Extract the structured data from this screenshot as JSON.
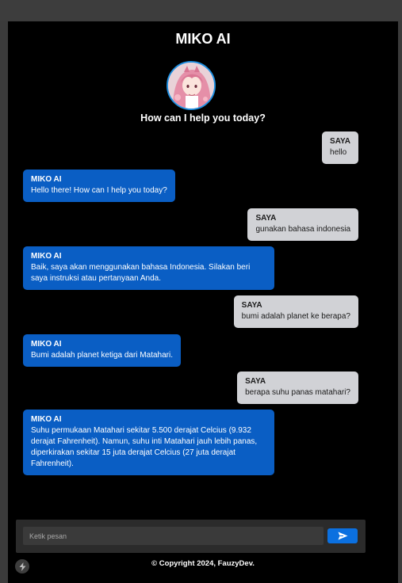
{
  "app": {
    "title": "MIKO AI",
    "subtitle": "How can I help you today?"
  },
  "messages": [
    {
      "role": "user",
      "sender": "SAYA",
      "text": "hello"
    },
    {
      "role": "ai",
      "sender": "MIKO AI",
      "text": "Hello there! How can I help you today?"
    },
    {
      "role": "user",
      "sender": "SAYA",
      "text": "gunakan bahasa indonesia"
    },
    {
      "role": "ai",
      "sender": "MIKO AI",
      "text": "Baik, saya akan menggunakan bahasa Indonesia. Silakan beri saya instruksi atau pertanyaan Anda."
    },
    {
      "role": "user",
      "sender": "SAYA",
      "text": "bumi adalah planet ke berapa?"
    },
    {
      "role": "ai",
      "sender": "MIKO AI",
      "text": "Bumi adalah planet ketiga dari Matahari."
    },
    {
      "role": "user",
      "sender": "SAYA",
      "text": "berapa suhu panas matahari?"
    },
    {
      "role": "ai",
      "sender": "MIKO AI",
      "text": "Suhu permukaan Matahari sekitar 5.500 derajat Celcius (9.932 derajat Fahrenheit). Namun, suhu inti Matahari jauh lebih panas, diperkirakan sekitar 15 juta derajat Celcius (27 juta derajat Fahrenheit)."
    }
  ],
  "composer": {
    "placeholder": "Ketik pesan",
    "send_icon": "send-icon"
  },
  "footer": {
    "copyright": "© Copyright 2024, FauzyDev."
  },
  "colors": {
    "background": "#000000",
    "ai_bubble": "#0a5ec4",
    "user_bubble": "#d1d2d6",
    "accent": "#0b70e0"
  }
}
